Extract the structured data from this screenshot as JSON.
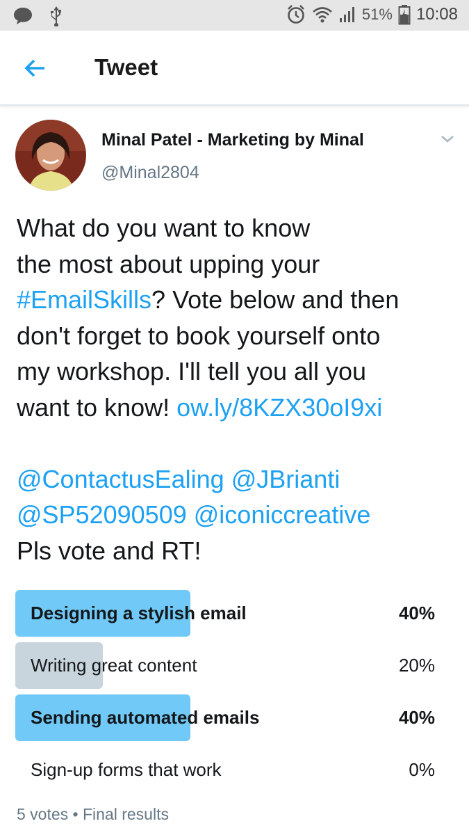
{
  "status_bar": {
    "icons": [
      "message-icon",
      "usb-icon",
      "alarm-icon",
      "wifi-icon",
      "signal-icon",
      "battery-icon"
    ],
    "battery": "51%",
    "time": "10:08"
  },
  "app_bar": {
    "back_icon": "arrow-left-icon",
    "title": "Tweet"
  },
  "tweet": {
    "author_name": "Minal Patel - Marketing by Minal",
    "handle": "@Minal2804",
    "text_lines": [
      [
        {
          "t": "What do you want to know",
          "link": false
        }
      ],
      [
        {
          "t": "the most about upping your",
          "link": false
        }
      ],
      [
        {
          "t": "#EmailSkills",
          "link": true
        },
        {
          "t": "? Vote below and then",
          "link": false
        }
      ],
      [
        {
          "t": "don't forget to book yourself onto",
          "link": false
        }
      ],
      [
        {
          "t": "my workshop. I'll tell you all you",
          "link": false
        }
      ],
      [
        {
          "t": "want to know! ",
          "link": false
        },
        {
          "t": "ow.ly/8KZX30oI9xi",
          "link": true
        }
      ],
      [
        {
          "t": "",
          "link": false
        }
      ],
      [
        {
          "t": "@ContactusEaling",
          "link": true
        },
        {
          "t": " ",
          "link": false
        },
        {
          "t": "@JBrianti",
          "link": true
        }
      ],
      [
        {
          "t": "@SP52090509",
          "link": true
        },
        {
          "t": " ",
          "link": false
        },
        {
          "t": "@iconiccreative",
          "link": true
        }
      ],
      [
        {
          "t": "Pls vote and RT!",
          "link": false
        }
      ]
    ],
    "link_color": "#1da1f2"
  },
  "poll": {
    "options": [
      {
        "label": "Designing a stylish email",
        "percent": "40%",
        "fraction": 0.4,
        "winner": true
      },
      {
        "label": "Writing great content",
        "percent": "20%",
        "fraction": 0.2,
        "winner": false
      },
      {
        "label": "Sending automated emails",
        "percent": "40%",
        "fraction": 0.4,
        "winner": true
      },
      {
        "label": "Sign-up forms that work",
        "percent": "0%",
        "fraction": 0.0,
        "winner": false
      }
    ],
    "winner_color": "#71c9f8",
    "other_color": "#c9d5dd",
    "footer": "5 votes • Final results"
  }
}
